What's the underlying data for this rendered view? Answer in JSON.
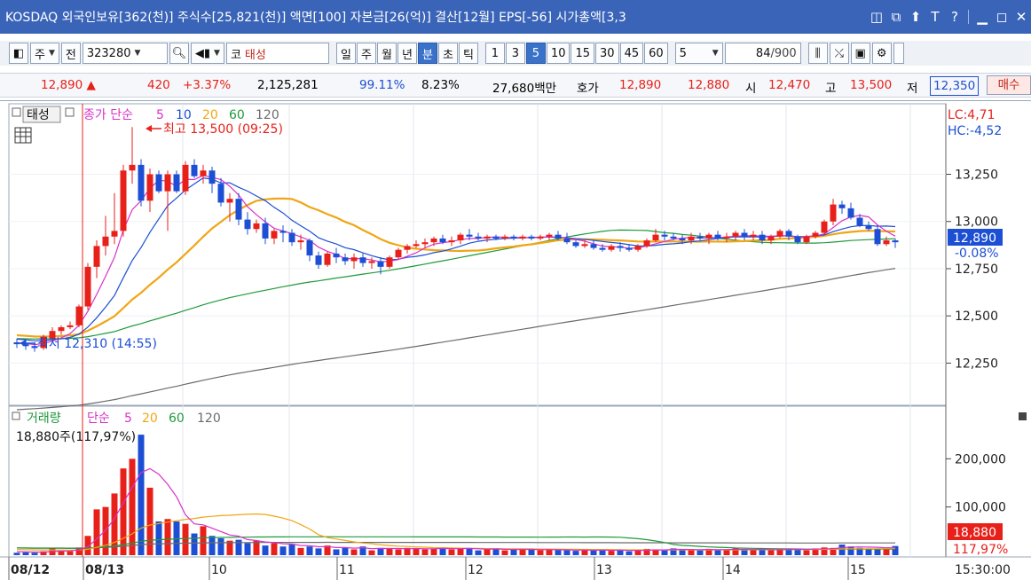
{
  "title": "KOSDAQ 외국인보유[362(천)] 주식수[25,821(천)] 액면[100] 자본금[26(억)] 결산[12월] EPS[-56] 시가총액[3,3",
  "window_buttons": [
    "◫",
    "⧉",
    "⬆",
    "T",
    "?",
    "▁",
    "◻",
    "✕"
  ],
  "colors": {
    "up": "#e8201a",
    "down": "#1c4fd4",
    "titlebar": "#3a64b8",
    "ma5": "#d931c8",
    "ma10": "#1c4fd4",
    "ma20": "#f0a614",
    "ma60": "#1f9a3a",
    "ma120": "#6b6b6b"
  },
  "toolbar": {
    "market_label": "주",
    "prev_label": "전",
    "code": "323280",
    "search_icon": "magnifier-icon",
    "market_code_prefix": "코",
    "stock_name": "태성",
    "periods": [
      "일",
      "주",
      "월",
      "년",
      "분",
      "초",
      "틱"
    ],
    "active_period": "분",
    "intervals": [
      "1",
      "3",
      "5",
      "10",
      "15",
      "30",
      "45",
      "60"
    ],
    "active_interval": "5",
    "interval_select": "5",
    "count": "84",
    "count_total": "/900"
  },
  "quote": {
    "price": "12,890",
    "change": "420",
    "change_pct": "+3.37%",
    "volume": "2,125,281",
    "vol_ratio": "99.11%",
    "turnover": "8.23%",
    "amount": "27,680백만",
    "hoga_label": "호가",
    "ask": "12,890",
    "bid": "12,880",
    "open_label": "시",
    "open": "12,470",
    "high_label": "고",
    "high": "13,500",
    "low_label": "저",
    "low": "12,350",
    "buy_button": "매수"
  },
  "price_panel": {
    "stock_tag": "태성",
    "legend_title": "종가 단순",
    "ma_periods": [
      "5",
      "10",
      "20",
      "60",
      "120"
    ],
    "high_annotation": "최고 13,500 (09:25)",
    "low_annotation": "최저 12,310 (14:55)",
    "lc": "LC:4,71",
    "hc": "HC:-4,52",
    "y_ticks": [
      "13,250",
      "13,000",
      "12,750",
      "12,500",
      "12,250"
    ],
    "current_price": "12,890",
    "current_pct": "-0.08%"
  },
  "volume_panel": {
    "legend_title": "거래량",
    "legend_sub": "단순",
    "ma_periods": [
      "5",
      "20",
      "60",
      "120"
    ],
    "current_text": "18,880주(117,97%)",
    "y_ticks": [
      "200,000",
      "100,000"
    ],
    "current_volume": "18,880",
    "current_pct": "117,97%"
  },
  "x_axis": {
    "dates": [
      "08/12",
      "08/13",
      "10",
      "11",
      "12",
      "13",
      "14",
      "15"
    ],
    "time": "15:30:00"
  },
  "chart_data": {
    "type": "candlestick",
    "candles": [
      {
        "o": 12360,
        "h": 12380,
        "l": 12330,
        "c": 12350
      },
      {
        "o": 12350,
        "h": 12370,
        "l": 12320,
        "c": 12340
      },
      {
        "o": 12340,
        "h": 12360,
        "l": 12310,
        "c": 12330
      },
      {
        "o": 12330,
        "h": 12400,
        "l": 12320,
        "c": 12390
      },
      {
        "o": 12380,
        "h": 12440,
        "l": 12360,
        "c": 12420
      },
      {
        "o": 12420,
        "h": 12450,
        "l": 12400,
        "c": 12440
      },
      {
        "o": 12440,
        "h": 12470,
        "l": 12430,
        "c": 12450
      },
      {
        "o": 12450,
        "h": 12560,
        "l": 12440,
        "c": 12550
      },
      {
        "o": 12550,
        "h": 12780,
        "l": 12530,
        "c": 12760
      },
      {
        "o": 12760,
        "h": 12900,
        "l": 12700,
        "c": 12870
      },
      {
        "o": 12870,
        "h": 13030,
        "l": 12820,
        "c": 12920
      },
      {
        "o": 12920,
        "h": 13150,
        "l": 12880,
        "c": 12950
      },
      {
        "o": 12950,
        "h": 13300,
        "l": 12920,
        "c": 13270
      },
      {
        "o": 13270,
        "h": 13500,
        "l": 13200,
        "c": 13300
      },
      {
        "o": 13300,
        "h": 13330,
        "l": 13080,
        "c": 13110
      },
      {
        "o": 13110,
        "h": 13280,
        "l": 13050,
        "c": 13250
      },
      {
        "o": 13250,
        "h": 13270,
        "l": 13150,
        "c": 13160
      },
      {
        "o": 13160,
        "h": 13270,
        "l": 12950,
        "c": 13250
      },
      {
        "o": 13250,
        "h": 13270,
        "l": 13150,
        "c": 13160
      },
      {
        "o": 13160,
        "h": 13320,
        "l": 13140,
        "c": 13300
      },
      {
        "o": 13300,
        "h": 13330,
        "l": 13230,
        "c": 13240
      },
      {
        "o": 13240,
        "h": 13300,
        "l": 13200,
        "c": 13270
      },
      {
        "o": 13270,
        "h": 13290,
        "l": 13150,
        "c": 13200
      },
      {
        "o": 13200,
        "h": 13230,
        "l": 13080,
        "c": 13100
      },
      {
        "o": 13100,
        "h": 13150,
        "l": 13000,
        "c": 13120
      },
      {
        "o": 13120,
        "h": 13150,
        "l": 12980,
        "c": 13010
      },
      {
        "o": 13010,
        "h": 13050,
        "l": 12930,
        "c": 12960
      },
      {
        "o": 12960,
        "h": 13010,
        "l": 12940,
        "c": 12990
      },
      {
        "o": 12990,
        "h": 13020,
        "l": 12880,
        "c": 12910
      },
      {
        "o": 12910,
        "h": 12960,
        "l": 12880,
        "c": 12950
      },
      {
        "o": 12950,
        "h": 12980,
        "l": 12890,
        "c": 12940
      },
      {
        "o": 12940,
        "h": 12960,
        "l": 12870,
        "c": 12890
      },
      {
        "o": 12890,
        "h": 12930,
        "l": 12850,
        "c": 12900
      },
      {
        "o": 12900,
        "h": 12910,
        "l": 12790,
        "c": 12820
      },
      {
        "o": 12820,
        "h": 12840,
        "l": 12750,
        "c": 12770
      },
      {
        "o": 12770,
        "h": 12840,
        "l": 12760,
        "c": 12830
      },
      {
        "o": 12830,
        "h": 12860,
        "l": 12780,
        "c": 12810
      },
      {
        "o": 12810,
        "h": 12830,
        "l": 12770,
        "c": 12790
      },
      {
        "o": 12790,
        "h": 12830,
        "l": 12750,
        "c": 12810
      },
      {
        "o": 12810,
        "h": 12830,
        "l": 12760,
        "c": 12780
      },
      {
        "o": 12780,
        "h": 12810,
        "l": 12750,
        "c": 12790
      },
      {
        "o": 12790,
        "h": 12810,
        "l": 12720,
        "c": 12760
      },
      {
        "o": 12760,
        "h": 12820,
        "l": 12750,
        "c": 12810
      },
      {
        "o": 12810,
        "h": 12860,
        "l": 12800,
        "c": 12850
      },
      {
        "o": 12850,
        "h": 12880,
        "l": 12830,
        "c": 12870
      },
      {
        "o": 12870,
        "h": 12900,
        "l": 12860,
        "c": 12880
      },
      {
        "o": 12880,
        "h": 12910,
        "l": 12860,
        "c": 12890
      },
      {
        "o": 12890,
        "h": 12920,
        "l": 12870,
        "c": 12910
      },
      {
        "o": 12910,
        "h": 12930,
        "l": 12880,
        "c": 12890
      },
      {
        "o": 12890,
        "h": 12920,
        "l": 12870,
        "c": 12900
      },
      {
        "o": 12900,
        "h": 12940,
        "l": 12880,
        "c": 12930
      },
      {
        "o": 12930,
        "h": 12960,
        "l": 12900,
        "c": 12920
      },
      {
        "o": 12920,
        "h": 12940,
        "l": 12900,
        "c": 12910
      },
      {
        "o": 12910,
        "h": 12930,
        "l": 12890,
        "c": 12920
      },
      {
        "o": 12920,
        "h": 12930,
        "l": 12900,
        "c": 12910
      },
      {
        "o": 12910,
        "h": 12930,
        "l": 12900,
        "c": 12920
      },
      {
        "o": 12920,
        "h": 12930,
        "l": 12900,
        "c": 12910
      },
      {
        "o": 12910,
        "h": 12930,
        "l": 12900,
        "c": 12920
      },
      {
        "o": 12920,
        "h": 12930,
        "l": 12900,
        "c": 12910
      },
      {
        "o": 12910,
        "h": 12930,
        "l": 12900,
        "c": 12920
      },
      {
        "o": 12920,
        "h": 12940,
        "l": 12900,
        "c": 12930
      },
      {
        "o": 12930,
        "h": 12950,
        "l": 12900,
        "c": 12910
      },
      {
        "o": 12910,
        "h": 12940,
        "l": 12880,
        "c": 12890
      },
      {
        "o": 12890,
        "h": 12900,
        "l": 12860,
        "c": 12870
      },
      {
        "o": 12870,
        "h": 12900,
        "l": 12860,
        "c": 12880
      },
      {
        "o": 12880,
        "h": 12900,
        "l": 12850,
        "c": 12860
      },
      {
        "o": 12860,
        "h": 12880,
        "l": 12840,
        "c": 12850
      },
      {
        "o": 12850,
        "h": 12880,
        "l": 12840,
        "c": 12870
      },
      {
        "o": 12870,
        "h": 12890,
        "l": 12840,
        "c": 12860
      },
      {
        "o": 12860,
        "h": 12880,
        "l": 12840,
        "c": 12850
      },
      {
        "o": 12850,
        "h": 12880,
        "l": 12840,
        "c": 12870
      },
      {
        "o": 12870,
        "h": 12910,
        "l": 12860,
        "c": 12900
      },
      {
        "o": 12900,
        "h": 12960,
        "l": 12890,
        "c": 12930
      },
      {
        "o": 12930,
        "h": 12950,
        "l": 12900,
        "c": 12920
      },
      {
        "o": 12920,
        "h": 12940,
        "l": 12900,
        "c": 12910
      },
      {
        "o": 12910,
        "h": 12930,
        "l": 12880,
        "c": 12900
      },
      {
        "o": 12900,
        "h": 12940,
        "l": 12880,
        "c": 12920
      },
      {
        "o": 12920,
        "h": 12940,
        "l": 12900,
        "c": 12910
      },
      {
        "o": 12910,
        "h": 12940,
        "l": 12880,
        "c": 12930
      },
      {
        "o": 12930,
        "h": 12950,
        "l": 12900,
        "c": 12910
      },
      {
        "o": 12910,
        "h": 12940,
        "l": 12890,
        "c": 12920
      },
      {
        "o": 12920,
        "h": 12950,
        "l": 12900,
        "c": 12940
      },
      {
        "o": 12940,
        "h": 12960,
        "l": 12900,
        "c": 12920
      },
      {
        "o": 12920,
        "h": 12950,
        "l": 12900,
        "c": 12930
      },
      {
        "o": 12930,
        "h": 12950,
        "l": 12880,
        "c": 12900
      },
      {
        "o": 12900,
        "h": 12930,
        "l": 12880,
        "c": 12920
      },
      {
        "o": 12920,
        "h": 12960,
        "l": 12910,
        "c": 12950
      },
      {
        "o": 12950,
        "h": 12960,
        "l": 12900,
        "c": 12920
      },
      {
        "o": 12920,
        "h": 12930,
        "l": 12880,
        "c": 12890
      },
      {
        "o": 12890,
        "h": 12930,
        "l": 12880,
        "c": 12920
      },
      {
        "o": 12920,
        "h": 12950,
        "l": 12910,
        "c": 12940
      },
      {
        "o": 12940,
        "h": 13010,
        "l": 12930,
        "c": 13000
      },
      {
        "o": 13000,
        "h": 13120,
        "l": 12980,
        "c": 13090
      },
      {
        "o": 13090,
        "h": 13110,
        "l": 13040,
        "c": 13070
      },
      {
        "o": 13070,
        "h": 13100,
        "l": 13010,
        "c": 13020
      },
      {
        "o": 13020,
        "h": 13040,
        "l": 12970,
        "c": 12980
      },
      {
        "o": 12980,
        "h": 13000,
        "l": 12950,
        "c": 12960
      },
      {
        "o": 12960,
        "h": 12980,
        "l": 12870,
        "c": 12880
      },
      {
        "o": 12880,
        "h": 12920,
        "l": 12870,
        "c": 12900
      },
      {
        "o": 12900,
        "h": 12910,
        "l": 12860,
        "c": 12890
      }
    ],
    "volume_values": [
      5,
      6,
      5,
      8,
      14,
      9,
      8,
      16,
      40,
      95,
      100,
      128,
      180,
      200,
      250,
      140,
      70,
      75,
      70,
      65,
      45,
      60,
      40,
      35,
      30,
      32,
      25,
      30,
      20,
      25,
      18,
      22,
      15,
      18,
      14,
      20,
      12,
      15,
      12,
      18,
      10,
      15,
      14,
      12,
      15,
      13,
      12,
      14,
      16,
      12,
      13,
      15,
      10,
      12,
      14,
      10,
      13,
      11,
      12,
      10,
      12,
      11,
      10,
      9,
      11,
      10,
      12,
      9,
      10,
      8,
      11,
      13,
      12,
      10,
      14,
      11,
      12,
      10,
      13,
      11,
      12,
      14,
      10,
      11,
      12,
      10,
      13,
      14,
      12,
      10,
      14,
      16,
      15,
      22,
      18,
      15,
      14,
      13,
      16,
      19
    ],
    "ymin_price": 12050,
    "ymax_price": 13600,
    "vmax": 265000
  }
}
